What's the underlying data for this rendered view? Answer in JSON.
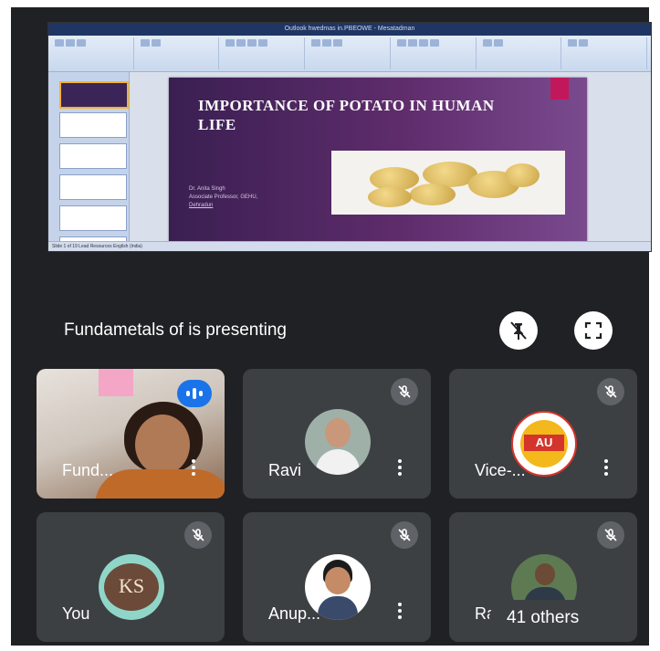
{
  "ppt": {
    "window_title": "Outlook hwedmas in.PBEOWE - Mesatadman",
    "slide_title": "IMPORTANCE OF POTATO IN HUMAN LIFE",
    "author_name": "Dr. Anita Singh",
    "author_role": "Associate Professor, GEHU,",
    "author_place": "Dehradun",
    "status_text": "Slide 1 of 19   Lead Resources   English (India)"
  },
  "presentation": {
    "presenting_text": "Fundametals of is presenting"
  },
  "participants": [
    {
      "name": "Fund...",
      "speaking": true,
      "muted": false,
      "kind": "video"
    },
    {
      "name": "Ravi",
      "muted": true,
      "kind": "photo"
    },
    {
      "name": "Vice-...",
      "muted": true,
      "kind": "logo",
      "logo_text": "AU"
    },
    {
      "name": "You",
      "muted": true,
      "kind": "logo",
      "logo_text": "KS"
    },
    {
      "name": "Anup...",
      "muted": true,
      "kind": "photo"
    },
    {
      "name": "Rai",
      "muted": true,
      "kind": "photo"
    }
  ],
  "others": {
    "label": "41 others"
  },
  "colors": {
    "background": "#202124",
    "tile": "#3c4043",
    "speaking": "#1a73e8",
    "slide": "#4a2460"
  },
  "icons": [
    "unpin-icon",
    "fullscreen-icon",
    "mic-off-icon",
    "more-options-icon",
    "speaking-indicator-icon"
  ]
}
